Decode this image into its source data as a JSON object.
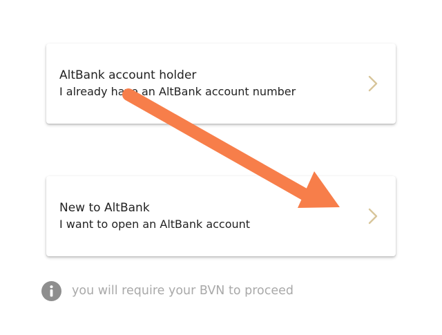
{
  "options": [
    {
      "title": "AltBank account holder",
      "subtitle": "I already have an AltBank account number",
      "icon": "chevron-right-icon"
    },
    {
      "title": "New to AltBank",
      "subtitle": "I want to open an AltBank account",
      "icon": "chevron-right-icon"
    }
  ],
  "notice": {
    "icon": "info-icon",
    "text": "you will require your BVN to proceed"
  },
  "annotation": {
    "icon": "arrow-annotation",
    "color": "#F77E4A"
  },
  "colors": {
    "chevron": "#D8C59A",
    "info_icon": "#8E8E8E",
    "notice_text": "#A9A9A9",
    "text": "#222222"
  }
}
